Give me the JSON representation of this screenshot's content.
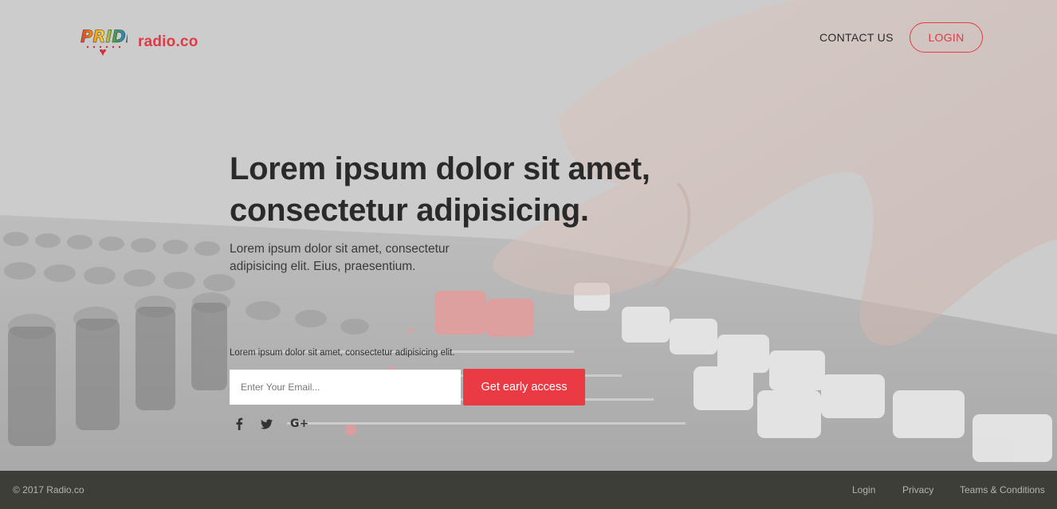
{
  "header": {
    "logo_text": "PRIDE",
    "brand": "radio.co",
    "nav_contact": "CONTACT US",
    "nav_login": "LOGIN"
  },
  "hero": {
    "headline_line1": "Lorem ipsum dolor sit amet,",
    "headline_line2": "consectetur adipisicing.",
    "sub_line1": "Lorem ipsum dolor sit amet, consectetur",
    "sub_line2": "adipisicing elit. Eius, praesentium.",
    "note": "Lorem ipsum dolor sit amet, consectetur adipisicing elit.",
    "email_placeholder": "Enter Your Email...",
    "cta_label": "Get early access"
  },
  "social": {
    "icons": [
      "facebook-icon",
      "twitter-icon",
      "google-plus-icon"
    ],
    "gplus_glyph": "G+"
  },
  "footer": {
    "copyright": "© 2017 Radio.co",
    "links": [
      "Login",
      "Privacy",
      "Teams & Conditions"
    ]
  },
  "colors": {
    "accent": "#ea3a44",
    "footer_bg": "#3e3e38",
    "hero_overlay": "#cbcbcb"
  }
}
